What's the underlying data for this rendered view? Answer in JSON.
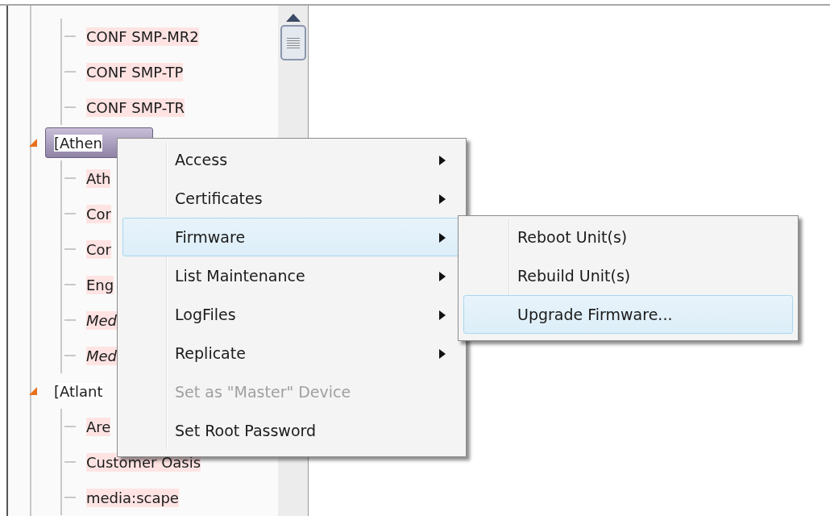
{
  "tree": {
    "items": [
      {
        "label": "CONF SMP-MR2",
        "kind": "leaf",
        "italic": false
      },
      {
        "label": "CONF SMP-TP",
        "kind": "leaf",
        "italic": false
      },
      {
        "label": "CONF SMP-TR",
        "kind": "leaf",
        "italic": false
      },
      {
        "label": "[Athen",
        "kind": "group",
        "expanded": true,
        "selected": true,
        "children": [
          {
            "label": "Ath",
            "kind": "leaf",
            "italic": false
          },
          {
            "label": "Cor",
            "kind": "leaf",
            "italic": false
          },
          {
            "label": "Cor",
            "kind": "leaf",
            "italic": false
          },
          {
            "label": "Eng",
            "kind": "leaf",
            "italic": false
          },
          {
            "label": "Med",
            "kind": "leaf",
            "italic": true
          },
          {
            "label": "Med",
            "kind": "leaf",
            "italic": true
          }
        ]
      },
      {
        "label": "[Atlant",
        "kind": "group",
        "expanded": true,
        "selected": false,
        "children": [
          {
            "label": "Are",
            "kind": "leaf",
            "italic": false
          },
          {
            "label": "Customer Oasis",
            "kind": "leaf",
            "italic": false
          },
          {
            "label": "media:scape",
            "kind": "leaf",
            "italic": false
          }
        ]
      }
    ]
  },
  "context_menu": {
    "items": [
      {
        "label": "Access",
        "kind": "submenu",
        "selected": false,
        "disabled": false
      },
      {
        "label": "Certificates",
        "kind": "submenu",
        "selected": false,
        "disabled": false
      },
      {
        "label": "Firmware",
        "kind": "submenu",
        "selected": true,
        "disabled": false
      },
      {
        "label": "List Maintenance",
        "kind": "submenu",
        "selected": false,
        "disabled": false
      },
      {
        "label": "LogFiles",
        "kind": "submenu",
        "selected": false,
        "disabled": false
      },
      {
        "label": "Replicate",
        "kind": "submenu",
        "selected": false,
        "disabled": false
      },
      {
        "label": "Set as \"Master\" Device",
        "kind": "action",
        "selected": false,
        "disabled": true
      },
      {
        "label": "Set Root Password",
        "kind": "action",
        "selected": false,
        "disabled": false
      }
    ]
  },
  "submenu": {
    "items": [
      {
        "label": "Reboot Unit(s)",
        "kind": "action",
        "selected": false,
        "disabled": false
      },
      {
        "label": "Rebuild Unit(s)",
        "kind": "action",
        "selected": false,
        "disabled": false
      },
      {
        "label": "Upgrade Firmware...",
        "kind": "action",
        "selected": true,
        "disabled": false
      }
    ]
  }
}
